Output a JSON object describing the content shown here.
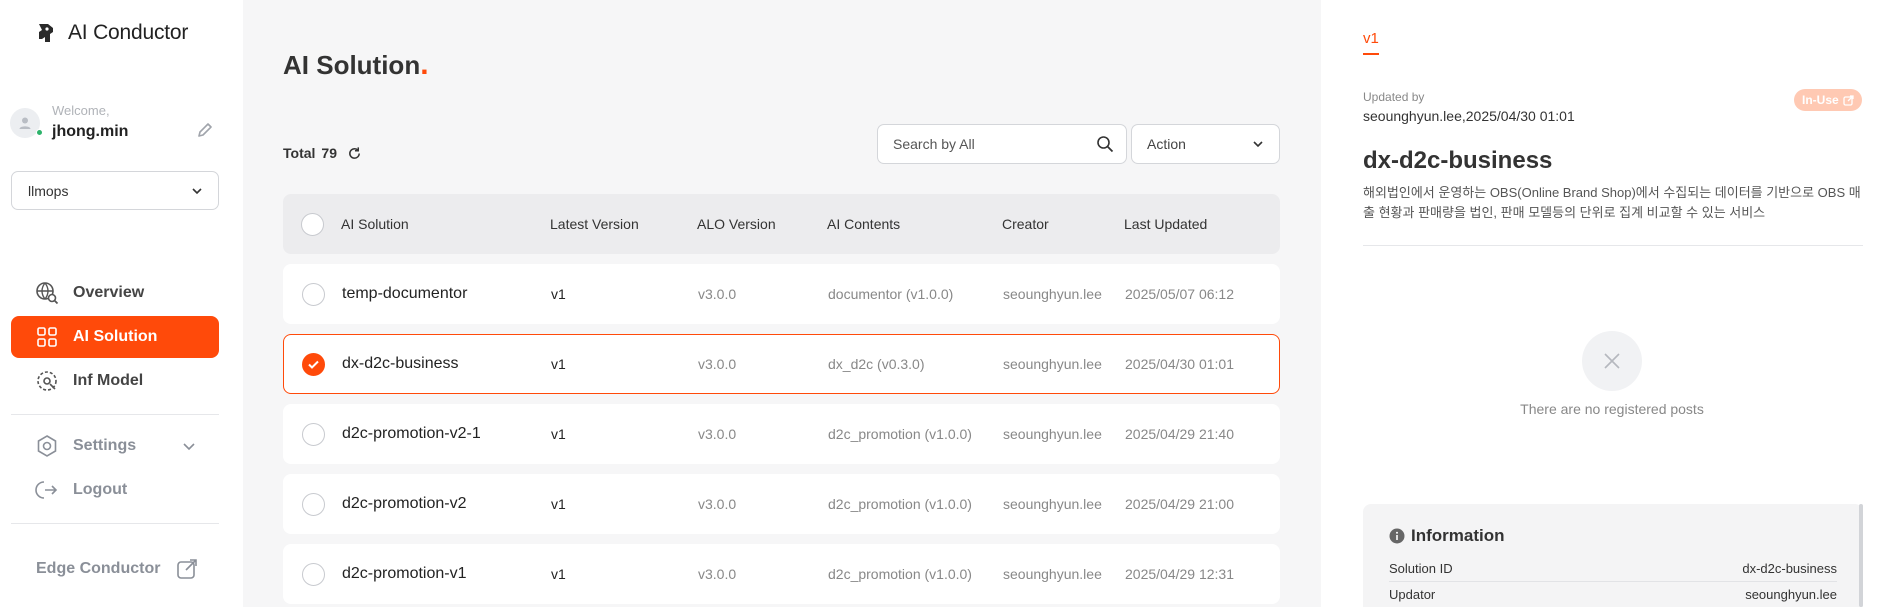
{
  "app": {
    "name": "AI Conductor"
  },
  "user": {
    "welcome": "Welcome,",
    "name": "jhong.min"
  },
  "project": {
    "selected": "llmops"
  },
  "nav": {
    "items": [
      {
        "label": "Overview"
      },
      {
        "label": "AI Solution"
      },
      {
        "label": "Inf Model"
      }
    ],
    "settings": "Settings",
    "logout": "Logout",
    "edge": "Edge Conductor"
  },
  "main": {
    "title": "AI Solution",
    "title_dot": ".",
    "total_label": "Total",
    "total_count": "79",
    "search_placeholder": "Search by All",
    "action_label": "Action",
    "columns": [
      "AI Solution",
      "Latest Version",
      "ALO Version",
      "AI Contents",
      "Creator",
      "Last Updated"
    ],
    "rows": [
      {
        "name": "temp-documentor",
        "version": "v1",
        "alo": "v3.0.0",
        "contents": "documentor (v1.0.0)",
        "creator": "seounghyun.lee",
        "updated": "2025/05/07 06:12",
        "checked": false
      },
      {
        "name": "dx-d2c-business",
        "version": "v1",
        "alo": "v3.0.0",
        "contents": "dx_d2c (v0.3.0)",
        "creator": "seounghyun.lee",
        "updated": "2025/04/30 01:01",
        "checked": true
      },
      {
        "name": "d2c-promotion-v2-1",
        "version": "v1",
        "alo": "v3.0.0",
        "contents": "d2c_promotion (v1.0.0)",
        "creator": "seounghyun.lee",
        "updated": "2025/04/29 21:40",
        "checked": false
      },
      {
        "name": "d2c-promotion-v2",
        "version": "v1",
        "alo": "v3.0.0",
        "contents": "d2c_promotion (v1.0.0)",
        "creator": "seounghyun.lee",
        "updated": "2025/04/29 21:00",
        "checked": false
      },
      {
        "name": "d2c-promotion-v1",
        "version": "v1",
        "alo": "v3.0.0",
        "contents": "d2c_promotion (v1.0.0)",
        "creator": "seounghyun.lee",
        "updated": "2025/04/29 12:31",
        "checked": false
      }
    ]
  },
  "panel": {
    "version_tab": "v1",
    "updated_by_label": "Updated by",
    "updated_by_value": "seounghyun.lee,2025/04/30 01:01",
    "status_badge": "In-Use",
    "title": "dx-d2c-business",
    "description": "해외법인에서 운영하는 OBS(Online Brand Shop)에서 수집되는 데이터를 기반으로 OBS 매출 현황과 판매량을 법인, 판매 모델등의 단위로 집계 비교할 수 있는 서비스",
    "empty_text": "There are no registered posts",
    "info_title": "Information",
    "info_rows": [
      {
        "label": "Solution ID",
        "value": "dx-d2c-business"
      },
      {
        "label": "Updator",
        "value": "seounghyun.lee"
      }
    ]
  },
  "colors": {
    "accent": "#ff4a0a",
    "badge": "#ffc9b3",
    "online": "#2db36b"
  }
}
